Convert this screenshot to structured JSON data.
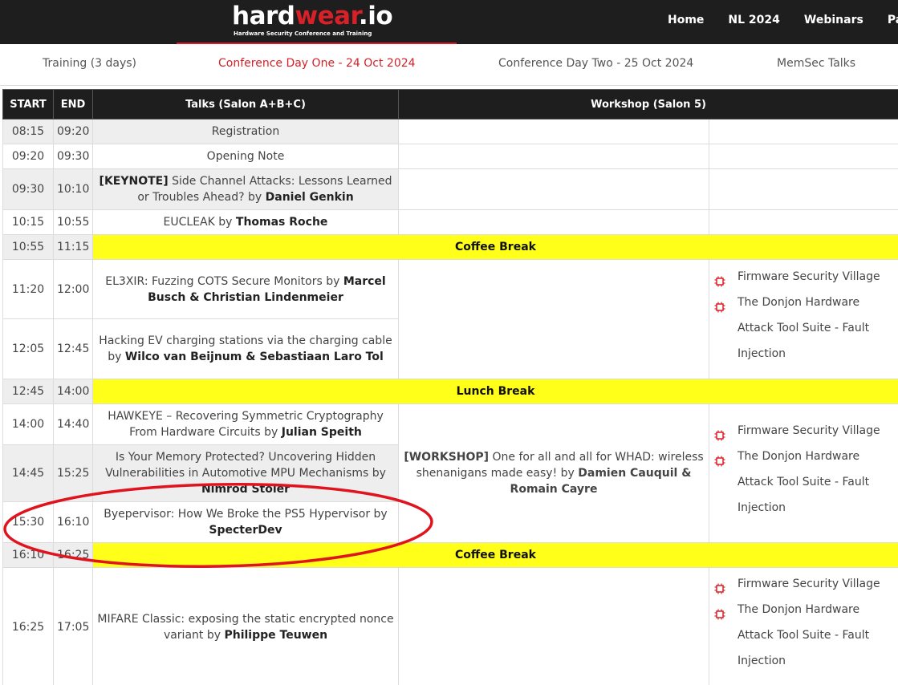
{
  "site": {
    "logo_part1": "hard",
    "logo_part2": "wear",
    "logo_part3": ".io",
    "logo_tagline": "Hardware Security Conference and Training"
  },
  "nav": [
    "Home",
    "NL 2024",
    "Webinars",
    "Past"
  ],
  "tabs": [
    {
      "label": "Training (3 days)",
      "active": false
    },
    {
      "label": "Conference Day One - 24 Oct 2024",
      "active": true
    },
    {
      "label": "Conference Day Two - 25 Oct 2024",
      "active": false
    },
    {
      "label": "MemSec Talks",
      "active": false
    }
  ],
  "table": {
    "headers": [
      "START",
      "END",
      "Talks (Salon A+B+C)",
      "Workshop (Salon 5)"
    ],
    "rows": [
      {
        "start": "08:15",
        "end": "09:20",
        "title": "Registration"
      },
      {
        "start": "09:20",
        "end": "09:30",
        "title": "Opening Note"
      },
      {
        "start": "09:30",
        "end": "10:10",
        "prefix": "[KEYNOTE]",
        "title": " Side Channel Attacks: Lessons Learned or Troubles Ahead? by ",
        "speaker": "Daniel Genkin"
      },
      {
        "start": "10:15",
        "end": "10:55",
        "title": "EUCLEAK by ",
        "speaker": "Thomas Roche"
      },
      {
        "start": "10:55",
        "end": "11:15",
        "break_label": "Coffee Break"
      },
      {
        "start": "11:20",
        "end": "12:00",
        "title": "EL3XIR: Fuzzing COTS Secure Monitors by ",
        "speaker": "Marcel Busch & Christian Lindenmeier"
      },
      {
        "start": "12:05",
        "end": "12:45",
        "title": "Hacking EV charging stations via the charging cable by ",
        "speaker": "Wilco van Beijnum & Sebastiaan Laro Tol"
      },
      {
        "start": "12:45",
        "end": "14:00",
        "break_label": "Lunch Break"
      },
      {
        "start": "14:00",
        "end": "14:40",
        "title": "HAWKEYE – Recovering Symmetric Cryptography From Hardware Circuits by ",
        "speaker": "Julian Speith"
      },
      {
        "start": "14:45",
        "end": "15:25",
        "title": "Is Your Memory Protected? Uncovering Hidden Vulnerabilities in Automotive MPU Mechanisms by ",
        "speaker": "Nimrod Stoler"
      },
      {
        "start": "15:30",
        "end": "16:10",
        "title": "Byepervisor: How We Broke the PS5 Hypervisor by ",
        "speaker": "SpecterDev"
      },
      {
        "start": "16:10",
        "end": "16:25",
        "break_label": "Coffee Break"
      },
      {
        "start": "16:25",
        "end": "17:05",
        "title": "MIFARE Classic: exposing the static encrypted nonce variant by ",
        "speaker": "Philippe Teuwen"
      }
    ],
    "workshop": {
      "prefix": "[WORKSHOP]",
      "title": " One for all and all for WHAD: wireless shenanigans made easy! by ",
      "speaker": "Damien Cauquil & Romain Cayre"
    },
    "villages": [
      "Firmware Security Village",
      "The Donjon Hardware Attack Tool Suite - Fault Injection"
    ]
  },
  "colors": {
    "accent": "#d72027",
    "header_bg": "#1e1e1e",
    "break_bg": "#ffff1a",
    "annotation": "#e0141e"
  },
  "icons": [
    "chip-icon"
  ]
}
